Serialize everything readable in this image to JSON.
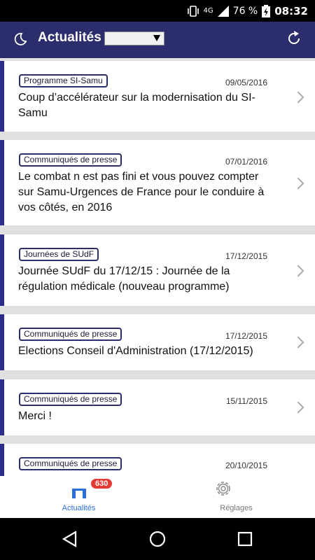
{
  "status": {
    "network": "4G",
    "battery": "76 %",
    "time": "08:32"
  },
  "header": {
    "title": "Actualités",
    "select_value": ""
  },
  "news": [
    {
      "category": "Programme SI-Samu",
      "date": "09/05/2016",
      "title": "Coup d’accélérateur sur la modernisation du SI-Samu"
    },
    {
      "category": "Communiqués de presse",
      "date": "07/01/2016",
      "title": "Le combat n est pas fini et vous pouvez compter sur Samu-Urgences de France pour le conduire à vos côtés, en 2016"
    },
    {
      "category": "Journées de SUdF",
      "date": "17/12/2015",
      "title": "Journée SUdF du 17/12/15 : Journée de la régulation médicale (nouveau programme)"
    },
    {
      "category": "Communiqués de presse",
      "date": "17/12/2015",
      "title": "Elections Conseil d'Administration (17/12/2015)"
    },
    {
      "category": "Communiqués de presse",
      "date": "15/11/2015",
      "title": "Merci !"
    },
    {
      "category": "Communiqués de presse",
      "date": "20/10/2015",
      "title": ""
    }
  ],
  "tabs": {
    "news_label": "Actualités",
    "news_badge": "630",
    "settings_label": "Réglages"
  },
  "colors": {
    "appbar": "#2b2d6c",
    "accent": "#2b2d8c",
    "badge": "#e53935",
    "active_tab": "#2a6fdb"
  }
}
